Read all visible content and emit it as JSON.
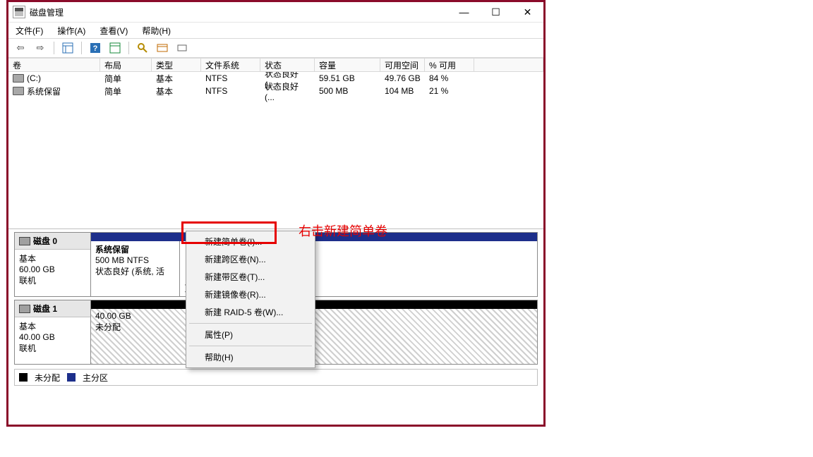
{
  "window": {
    "title": "磁盘管理"
  },
  "menubar": {
    "file": "文件(F)",
    "action": "操作(A)",
    "view": "查看(V)",
    "help": "帮助(H)"
  },
  "vol_table": {
    "headers": {
      "volume": "卷",
      "layout": "布局",
      "type": "类型",
      "fs": "文件系统",
      "status": "状态",
      "capacity": "容量",
      "free": "可用空间",
      "pct_free": "% 可用"
    },
    "rows": [
      {
        "volume": "(C:)",
        "layout": "简单",
        "type": "基本",
        "fs": "NTFS",
        "status": "状态良好 (...",
        "capacity": "59.51 GB",
        "free": "49.76 GB",
        "pct_free": "84 %"
      },
      {
        "volume": "系统保留",
        "layout": "简单",
        "type": "基本",
        "fs": "NTFS",
        "status": "状态良好 (...",
        "capacity": "500 MB",
        "free": "104 MB",
        "pct_free": "21 %"
      }
    ]
  },
  "disks": [
    {
      "name": "磁盘 0",
      "type": "基本",
      "size": "60.00 GB",
      "status": "联机",
      "topbar": "primary",
      "parts": [
        {
          "title": "系统保留",
          "line2": "500 MB NTFS",
          "line3": "状态良好 (系统, 活",
          "width": "20%",
          "hatch": false
        },
        {
          "title": "",
          "line2": "",
          "line3": "页面文件, 故障转储, 主分区)",
          "width": "80%",
          "hatch": false
        }
      ]
    },
    {
      "name": "磁盘 1",
      "type": "基本",
      "size": "40.00 GB",
      "status": "联机",
      "topbar": "unalloc",
      "parts": [
        {
          "title": "",
          "line2": "40.00 GB",
          "line3": "未分配",
          "width": "100%",
          "hatch": true
        }
      ]
    }
  ],
  "legend": {
    "unalloc": "未分配",
    "primary": "主分区"
  },
  "context_menu": {
    "items": [
      "新建简单卷(I)...",
      "新建跨区卷(N)...",
      "新建带区卷(T)...",
      "新建镜像卷(R)...",
      "新建 RAID-5 卷(W)..."
    ],
    "properties": "属性(P)",
    "help": "帮助(H)"
  },
  "annotation": "右击新建简单卷"
}
